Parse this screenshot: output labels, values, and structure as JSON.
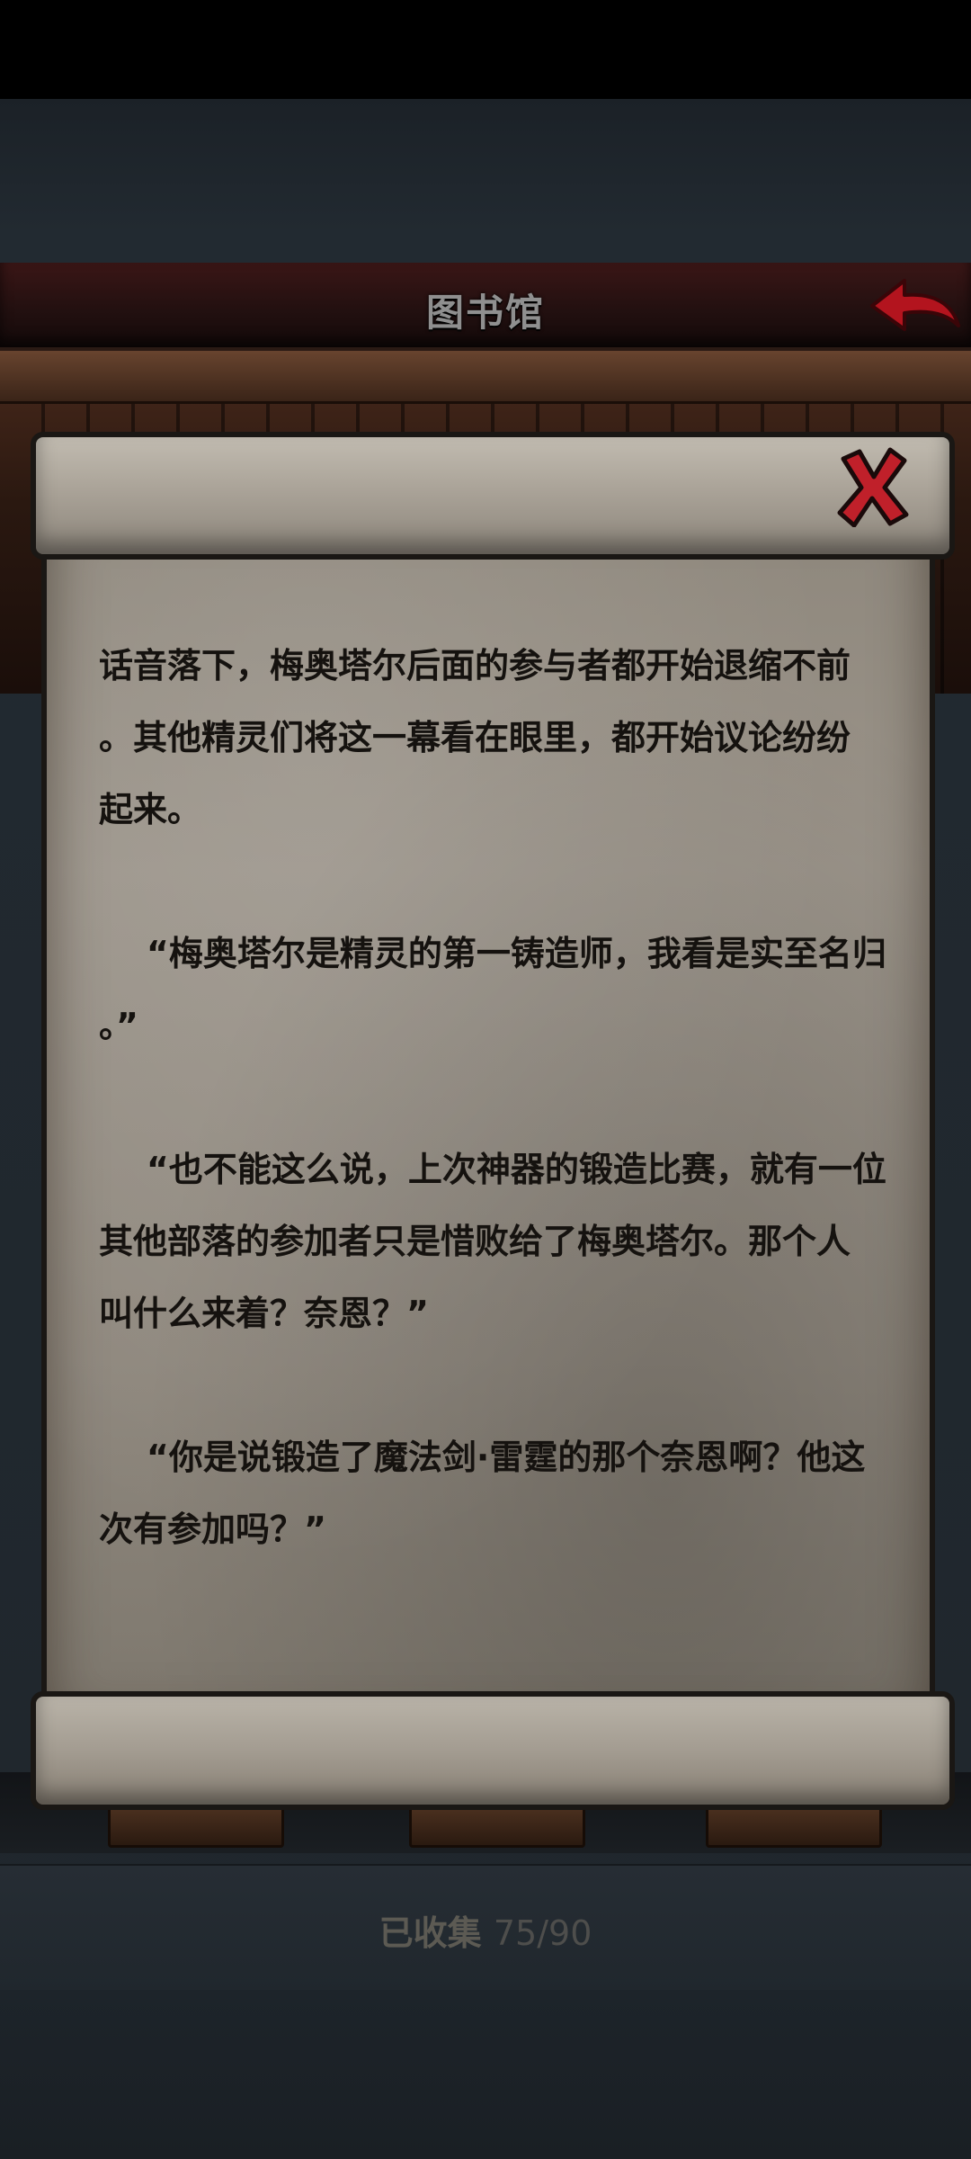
{
  "header": {
    "title": "图书馆"
  },
  "scroll": {
    "paragraphs": [
      "话音落下，梅奥塔尔后面的参与者都开始退缩不前\n。其他精灵们将这一幕看在眼里，都开始议论纷纷\n起来。",
      "    “梅奥塔尔是精灵的第一铸造师，我看是实至名归\n。”",
      "    “也不能这么说，上次神器的锻造比赛，就有一位\n其他部落的参加者只是惜败给了梅奥塔尔。那个人\n叫什么来着？奈恩？”",
      "    “你是说锻造了魔法剑·雷霆的那个奈恩啊？他这\n次有参加吗？”"
    ]
  },
  "footer": {
    "collected_label": "已收集",
    "collected_count": "75/90"
  },
  "colors": {
    "header_bg": "#2a1212",
    "parchment": "#958e84",
    "close_red": "#c0202a",
    "text": "#15120f"
  },
  "icons": {
    "back": "red-arrow-back-icon",
    "close": "red-x-close-icon"
  }
}
